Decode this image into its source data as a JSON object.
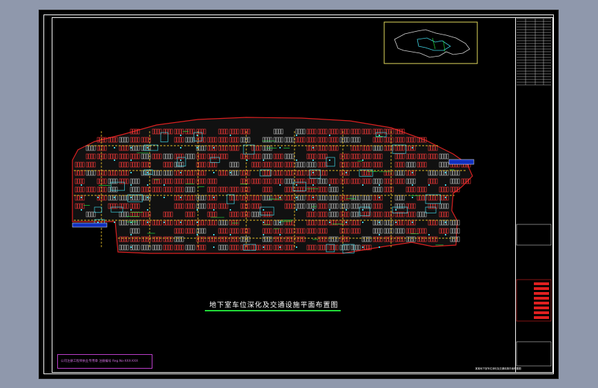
{
  "drawing": {
    "title": "地下室车位深化及交通设施平面布置图",
    "stamp_text": "公司注册工程师执业专用章 注册编号 Reg.No-XXX-XXX",
    "bottom_note": "某某地下室车位深化及交通设施平面布置图"
  },
  "colors": {
    "background": "#000000",
    "frame": "#ffffff",
    "boundary": "#e02020",
    "parking": "#ff3a3a",
    "lanes": "#e8c028",
    "walls": "#40d8e8",
    "green_lines": "#20e040",
    "title_underline": "#22e03a",
    "keymap_border": "#e8e060",
    "stamp_border": "#c040d0"
  },
  "title_block": {
    "row_count": 24
  }
}
